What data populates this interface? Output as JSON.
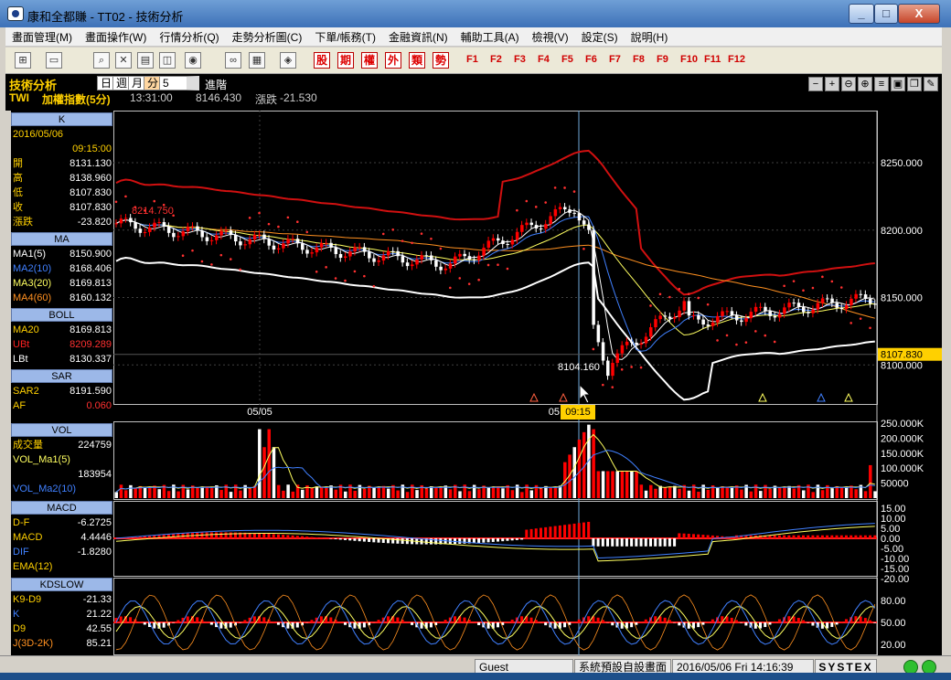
{
  "window": {
    "title": "康和全都賺 - TT02 - 技術分析",
    "btn_min": "_",
    "btn_max": "□",
    "btn_close": "X"
  },
  "menu": [
    "畫面管理(M)",
    "畫面操作(W)",
    "行情分析(Q)",
    "走勢分析圖(C)",
    "下單/帳務(T)",
    "金融資訊(N)",
    "輔助工具(A)",
    "檢視(V)",
    "設定(S)",
    "說明(H)"
  ],
  "toolbar": {
    "icon_buttons": [
      "grid-icon",
      "window-icon",
      "search-icon",
      "close-icon",
      "layout-icon",
      "split-icon",
      "compass-icon",
      "link-icon",
      "chart-icon",
      "logo-icon"
    ],
    "red_buttons": [
      "股",
      "期",
      "權",
      "外",
      "類",
      "勢"
    ],
    "fkeys": [
      "F1",
      "F2",
      "F3",
      "F4",
      "F5",
      "F6",
      "F7",
      "F8",
      "F9",
      "F10",
      "F11",
      "F12"
    ]
  },
  "header": {
    "title": "技術分析",
    "periods": [
      "日",
      "週",
      "月",
      "分"
    ],
    "selected_period": "分",
    "minutes": "5",
    "advanced": "進階",
    "symbol": "TWI",
    "name": "加權指數(5分)",
    "time": "13:31:00",
    "price": "8146.430",
    "change_label": "漲跌",
    "change": "-21.530"
  },
  "panel": {
    "k_header": "K",
    "date": "2016/05/06",
    "time": "09:15:00",
    "ohlc": [
      {
        "k": "開",
        "v": "8131.130"
      },
      {
        "k": "高",
        "v": "8138.960"
      },
      {
        "k": "低",
        "v": "8107.830"
      },
      {
        "k": "收",
        "v": "8107.830"
      },
      {
        "k": "漲跌",
        "v": "-23.820"
      }
    ],
    "ma_header": "MA",
    "ma": [
      {
        "k": "MA1(5)",
        "v": "8150.900"
      },
      {
        "k": "MA2(10)",
        "v": "8168.406"
      },
      {
        "k": "MA3(20)",
        "v": "8169.813"
      },
      {
        "k": "MA4(60)",
        "v": "8160.132"
      }
    ],
    "boll_header": "BOLL",
    "boll": [
      {
        "k": "MA20",
        "v": "8169.813"
      },
      {
        "k": "UBt",
        "v": "8209.289"
      },
      {
        "k": "LBt",
        "v": "8130.337"
      }
    ],
    "sar_header": "SAR",
    "sar": [
      {
        "k": "SAR2",
        "v": "8191.590"
      },
      {
        "k": "AF",
        "v": "0.060"
      }
    ],
    "vol_header": "VOL",
    "vol": [
      {
        "k": "成交量",
        "v": "224759"
      },
      {
        "k": "VOL_Ma1(5)",
        "v": ""
      },
      {
        "k": "",
        "v": "183954"
      },
      {
        "k": "VOL_Ma2(10)",
        "v": ""
      }
    ],
    "macd_header": "MACD",
    "macd": [
      {
        "k": "D-F",
        "v": "-6.2725"
      },
      {
        "k": "MACD",
        "v": "4.4446"
      },
      {
        "k": "DIF",
        "v": "-1.8280"
      },
      {
        "k": "EMA(12)",
        "v": ""
      }
    ],
    "kd_header": "KDSLOW",
    "kd": [
      {
        "k": "K9-D9",
        "v": "-21.33"
      },
      {
        "k": "K",
        "v": "21.22"
      },
      {
        "k": "D9",
        "v": "42.55"
      },
      {
        "k": "J(3D-2K)",
        "v": "85.21"
      }
    ]
  },
  "chart": {
    "price_ticks": [
      "8250.000",
      "8200.000",
      "8150.000",
      "8100.000"
    ],
    "current_price": "8107.830",
    "low_label": "8104.160",
    "high_label": "8214.750",
    "date_label": "05/05",
    "cursor_date": "05",
    "cursor_time": "09:15",
    "vol_ticks": [
      "250.000K",
      "200.000K",
      "150.000K",
      "100.000K",
      "50000"
    ],
    "macd_ticks": [
      "15.00",
      "10.00",
      "5.00",
      "0.00",
      "-5.00",
      "-10.00",
      "-15.00",
      "-20.00"
    ],
    "kd_ticks": [
      "80.00",
      "50.00",
      "20.00"
    ]
  },
  "status": {
    "user": "Guest",
    "page": "系統預設自設畫面",
    "datetime": "2016/05/06 Fri 14:16:39",
    "brand": "SYSTEX"
  },
  "colors": {
    "up": "#ff0000",
    "down": "#ffffff",
    "upper_band": "#d01010",
    "lower_band": "#ffffff",
    "sar": "#ff3030",
    "ma5": "#ffffff",
    "ma10": "#4080ff",
    "ma20": "#ffff60",
    "ma60": "#ff9020"
  }
}
